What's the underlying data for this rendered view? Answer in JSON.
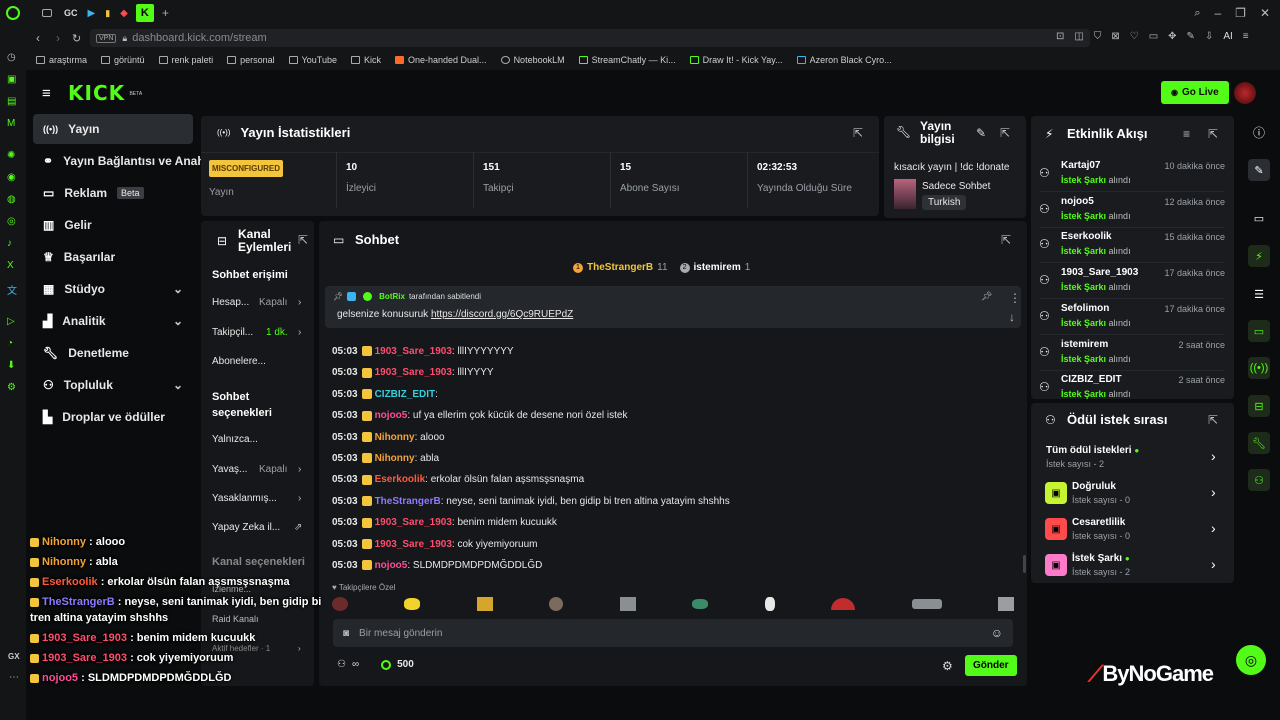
{
  "browser": {
    "tab_labels": [
      "GC"
    ],
    "url": "dashboard.kick.com/stream",
    "vpn": "VPN",
    "ai": "AI",
    "bookmarks": [
      "araştırma",
      "görüntü",
      "renk paleti",
      "personal",
      "YouTube",
      "Kick",
      "One-handed Dual...",
      "NotebookLM",
      "StreamChatly — Ki...",
      "Draw It! - Kick Yay...",
      "Azeron Black Cyro..."
    ]
  },
  "header": {
    "logo": "KICK",
    "logo_beta": "BETA",
    "go_live": "Go Live"
  },
  "nav": {
    "items": [
      "Yayın",
      "Yayın Bağlantısı ve Anahtar",
      "Reklam",
      "Gelir",
      "Başarılar",
      "Stüdyo",
      "Analitik",
      "Denetleme",
      "Topluluk",
      "Droplar ve ödüller"
    ],
    "reklam_badge": "Beta"
  },
  "stats": {
    "title": "Yayın İstatistikleri",
    "status_badge": "MISCONFIGURED",
    "status_label": "Yayın",
    "items": [
      {
        "value": "10",
        "label": "İzleyici"
      },
      {
        "value": "151",
        "label": "Takipçi"
      },
      {
        "value": "15",
        "label": "Abone Sayısı"
      },
      {
        "value": "02:32:53",
        "label": "Yayında Olduğu Süre"
      }
    ]
  },
  "stream_info": {
    "title": "Yayın bilgisi",
    "stream_title": "kısacık yayın | !dc !donate",
    "category": "Sadece Sohbet",
    "language": "Turkish"
  },
  "channel_actions": {
    "title": "Kanal Eylemleri",
    "chat_access": "Sohbet erişimi",
    "rows1": [
      {
        "label": "Hesap...",
        "value": "Kapalı"
      },
      {
        "label": "Takipçil...",
        "value": "1 dk."
      },
      {
        "label": "Abonelere...",
        "value": ""
      }
    ],
    "chat_options": "Sohbet seçenekleri",
    "rows2": [
      {
        "label": "Yalnızca...",
        "value": ""
      },
      {
        "label": "Yavaş...",
        "value": "Kapalı"
      },
      {
        "label": "Yasaklanmış...",
        "value": ""
      },
      {
        "label": "Yapay Zeka il...",
        "value": ""
      }
    ],
    "channel_options": "Kanal seçenekleri",
    "rows3": [
      {
        "label": "İzlenme...",
        "value": ""
      },
      {
        "label": "Raid Kanalı",
        "value": ""
      },
      {
        "label": "Aktif hedefler · 1",
        "value": ""
      }
    ]
  },
  "chat": {
    "title": "Sohbet",
    "top_users": [
      {
        "name": "TheStrangerB",
        "count": "11"
      },
      {
        "name": "istemirem",
        "count": "1"
      }
    ],
    "pinned_by": "BotRix",
    "pinned_suffix": "tarafından sabitlendi",
    "pinned_text": "gelsenize konusuruk ",
    "pinned_link": "https://discord.gg/6Qc9RUEPdZ",
    "messages": [
      {
        "time": "05:03",
        "user": "1903_Sare_1903",
        "color": "#ff4d6d",
        "text": ": lllIYYYYYYY"
      },
      {
        "time": "05:03",
        "user": "1903_Sare_1903",
        "color": "#ff4d6d",
        "text": ": lllIYYYY"
      },
      {
        "time": "05:03",
        "user": "CIZBIZ_EDIT",
        "color": "#33d1e0",
        "text": ":"
      },
      {
        "time": "05:03",
        "user": "nojoo5",
        "color": "#ff4d9a",
        "text": ": uf ya ellerim çok kücük de desene nori özel istek"
      },
      {
        "time": "05:03",
        "user": "Nihonny",
        "color": "#f2a33a",
        "text": ": alooo"
      },
      {
        "time": "05:03",
        "user": "Nihonny",
        "color": "#f2a33a",
        "text": ": abla"
      },
      {
        "time": "05:03",
        "user": "Eserkoolik",
        "color": "#ff5a3c",
        "text": ": erkolar ölsün falan aşsmsşsnaşma"
      },
      {
        "time": "05:03",
        "user": "TheStrangerB",
        "color": "#8b7cff",
        "text": ": neyse, seni tanimak iyidi, ben gidip bi tren altina yatayim shshhs"
      },
      {
        "time": "05:03",
        "user": "1903_Sare_1903",
        "color": "#ff4d6d",
        "text": ": benim midem kucuukk"
      },
      {
        "time": "05:03",
        "user": "1903_Sare_1903",
        "color": "#ff4d6d",
        "text": ": cok yiyemiyoruum"
      },
      {
        "time": "05:03",
        "user": "nojoo5",
        "color": "#ff4d9a",
        "text": ": SLDMDPDMDPDMĞDDLĞD"
      }
    ],
    "emote_label": "Takipçilere Özel",
    "input_placeholder": "Bir mesaj gönderin",
    "points": "500",
    "send": "Gönder"
  },
  "activity": {
    "title": "Etkinlik Akışı",
    "items": [
      {
        "name": "Kartaj07",
        "action": "İstek Şarkı",
        "suffix": "alındı",
        "time": "10 dakika önce"
      },
      {
        "name": "nojoo5",
        "action": "İstek Şarkı",
        "suffix": "alındı",
        "time": "12 dakika önce"
      },
      {
        "name": "Eserkoolik",
        "action": "İstek Şarkı",
        "suffix": "alındı",
        "time": "15 dakika önce"
      },
      {
        "name": "1903_Sare_1903",
        "action": "İstek Şarkı",
        "suffix": "alındı",
        "time": "17 dakika önce"
      },
      {
        "name": "Sefolimon",
        "action": "İstek Şarkı",
        "suffix": "alındı",
        "time": "17 dakika önce"
      },
      {
        "name": "istemirem",
        "action": "İstek Şarkı",
        "suffix": "alındı",
        "time": "2 saat önce"
      },
      {
        "name": "CIZBIZ_EDIT",
        "action": "İstek Şarkı",
        "suffix": "alındı",
        "time": "2 saat önce"
      }
    ]
  },
  "rewards": {
    "title": "Ödül istek sırası",
    "items": [
      {
        "name": "Tüm ödül istekleri",
        "sub": "İstek sayısı - 2",
        "color": "",
        "dot": true
      },
      {
        "name": "Doğruluk",
        "sub": "İstek sayısı - 0",
        "color": "#c6f432",
        "dot": false
      },
      {
        "name": "Cesaretlilik",
        "sub": "İstek sayısı - 0",
        "color": "#ff4b4b",
        "dot": false
      },
      {
        "name": "İstek Şarkı",
        "sub": "İstek sayısı - 2",
        "color": "#ff7ac8",
        "dot": true
      }
    ]
  },
  "overlay": {
    "messages": [
      {
        "user": "Nihonny",
        "color": "#f2a33a",
        "text": " : alooo"
      },
      {
        "user": "Nihonny",
        "color": "#f2a33a",
        "text": " : abla"
      },
      {
        "user": "Eserkoolik",
        "color": "#ff5a3c",
        "text": " : erkolar ölsün falan aşsmsşsnaşma"
      },
      {
        "user": "TheStrangerB",
        "color": "#8b7cff",
        "text": " : neyse, seni tanimak iyidi, ben gidip bi"
      },
      {
        "user": "",
        "color": "",
        "text": "tren altina yatayim shshhs"
      },
      {
        "user": "1903_Sare_1903",
        "color": "#ff4d6d",
        "text": " : benim midem kucuukk"
      },
      {
        "user": "1903_Sare_1903",
        "color": "#ff4d6d",
        "text": " : cok yiyemiyoruum"
      },
      {
        "user": "nojoo5",
        "color": "#ff4d9a",
        "text": " : SLDMDPDMDPDMĞDDLĞD"
      }
    ],
    "watermark": "ByNoGame",
    "gx_label": "GX"
  },
  "colors": {
    "accent": "#53fc18",
    "panel": "#191b1f",
    "bg": "#0b0c0d"
  }
}
